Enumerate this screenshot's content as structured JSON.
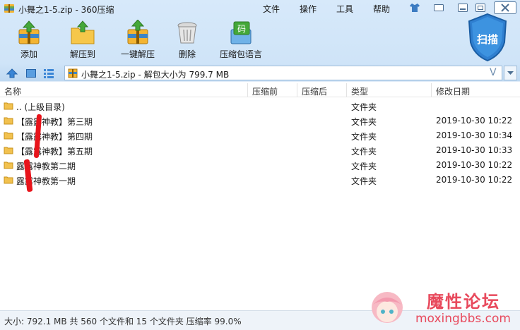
{
  "title": "小舞之1-5.zip - 360压缩",
  "menu": [
    "文件",
    "操作",
    "工具",
    "帮助"
  ],
  "toolbar": {
    "add": "添加",
    "extract_to": "解压到",
    "one_click_extract": "一键解压",
    "delete": "删除",
    "language": "压缩包语言",
    "scan": "扫描",
    "language_icon_text": "码"
  },
  "address": {
    "value": "小舞之1-5.zip - 解包大小为 799.7 MB",
    "v_mark": "V"
  },
  "columns": {
    "name": "名称",
    "packed": "压缩前",
    "compressed": "压缩后",
    "type": "类型",
    "modified": "修改日期"
  },
  "rows": [
    {
      "name": ".. (上级目录)",
      "type": "文件夹",
      "date": ""
    },
    {
      "name": "【露露神教】第三期",
      "type": "文件夹",
      "date": "2019-10-30 10:22"
    },
    {
      "name": "【露露神教】第四期",
      "type": "文件夹",
      "date": "2019-10-30 10:34"
    },
    {
      "name": "【露露神教】第五期",
      "type": "文件夹",
      "date": "2019-10-30 10:33"
    },
    {
      "name": "露露神教第二期",
      "type": "文件夹",
      "date": "2019-10-30 10:22"
    },
    {
      "name": "露露神教第一期",
      "type": "文件夹",
      "date": "2019-10-30 10:22"
    }
  ],
  "status": "大小: 792.1 MB 共 560 个文件和 15 个文件夹 压缩率 99.0%",
  "watermark": {
    "title": "魔性论坛",
    "subtitle": "moxingbbs.com"
  },
  "colors": {
    "accent": "#2f7fd0",
    "scan_shield": "#1f78c8",
    "folder": "#f2c14e",
    "redact": "#e8141b",
    "watermark": "#e8495c"
  }
}
